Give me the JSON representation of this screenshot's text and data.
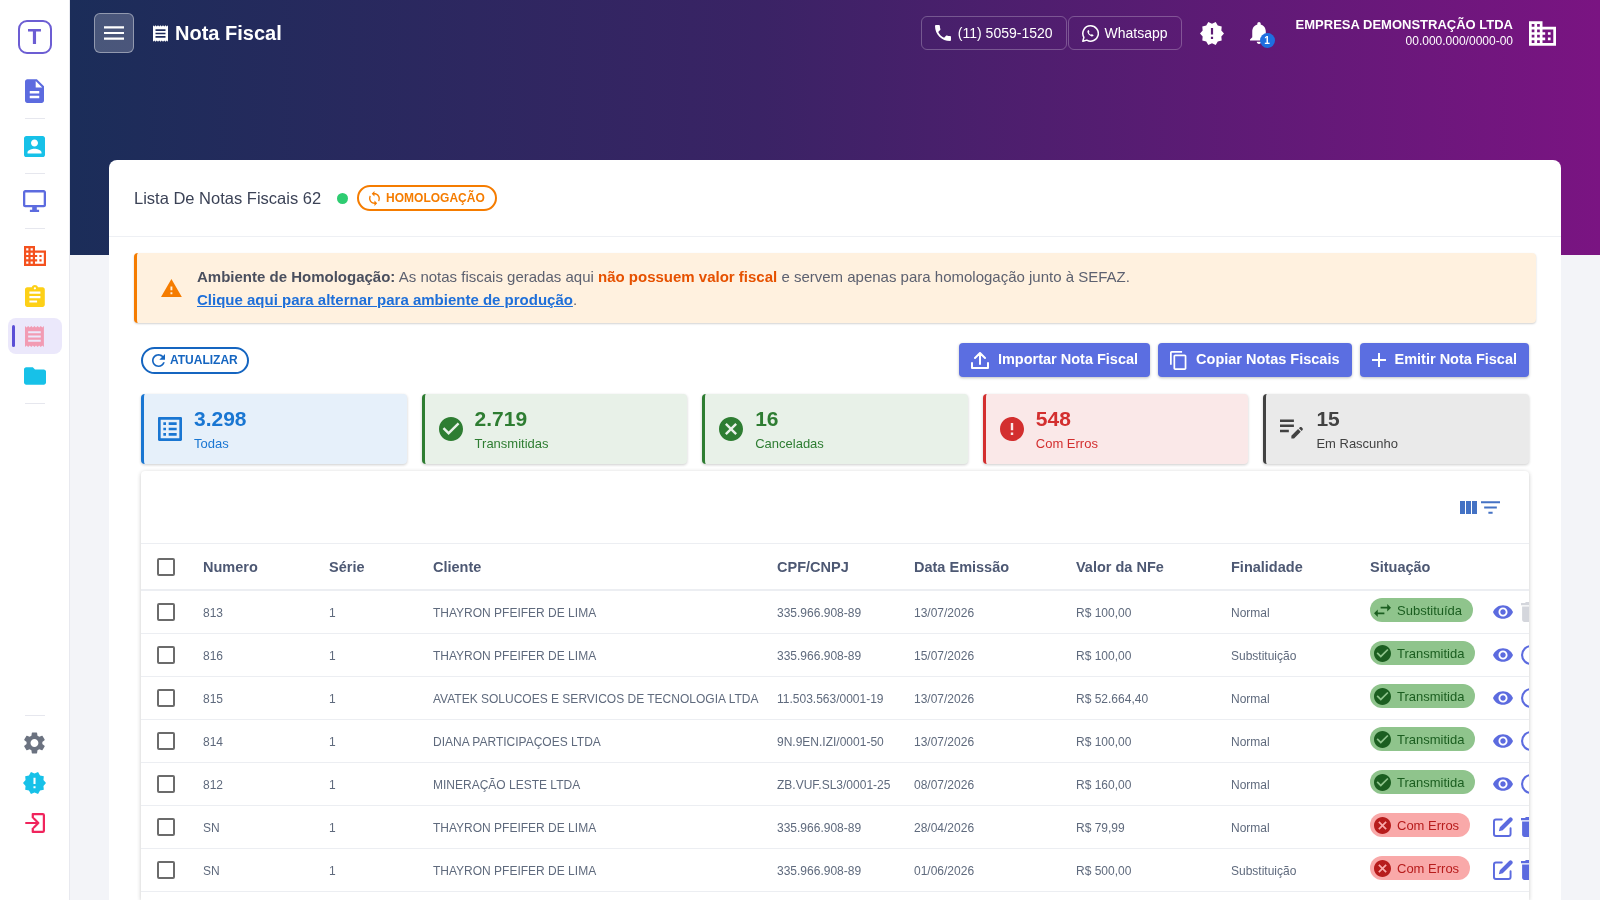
{
  "sidebar": {
    "logo": "T",
    "groups": [
      {
        "items": [
          {
            "kind": "document",
            "selected": false
          }
        ]
      },
      {
        "items": [
          {
            "kind": "contact",
            "selected": false
          }
        ]
      },
      {
        "items": [
          {
            "kind": "monitor",
            "selected": false
          }
        ]
      },
      {
        "items": [
          {
            "kind": "building",
            "selected": false
          },
          {
            "kind": "clipboard",
            "selected": false
          },
          {
            "kind": "receipt",
            "selected": true
          },
          {
            "kind": "folder",
            "selected": false
          }
        ]
      }
    ],
    "bottom_items": [
      {
        "kind": "settings",
        "selected": false
      },
      {
        "kind": "alert",
        "selected": false
      },
      {
        "kind": "logout",
        "selected": false
      }
    ]
  },
  "header": {
    "title": "Nota Fiscal",
    "phone": "(11) 5059-1520",
    "whatsapp": "Whatsapp",
    "notifications": "1",
    "company": {
      "name": "EMPRESA DEMONSTRAÇÃO LTDA",
      "tax_id": "00.000.000/0000-00"
    }
  },
  "list": {
    "title": "Lista De Notas Fiscais 62",
    "online": true,
    "environment": "HOMOLOGAÇÃO"
  },
  "alert": {
    "title": "Ambiente de Homologação:",
    "text": "As notas fiscais geradas aqui **não possuem valor fiscal** e servem apenas para homologação junto à SEFAZ.",
    "link": "Clique aqui para alternar para ambiente de produção",
    "end": "."
  },
  "toolbar": {
    "refresh": "ATUALIZAR",
    "actions": [
      {
        "kind": "import",
        "label": "Importar Nota Fiscal"
      },
      {
        "kind": "copy",
        "label": "Copiar Notas Fiscais"
      },
      {
        "kind": "create",
        "label": "Emitir Nota Fiscal"
      }
    ]
  },
  "stats": [
    {
      "kind": "all",
      "value": "3.298",
      "label": "Todas",
      "color": "#1976d2"
    },
    {
      "kind": "transmitted",
      "value": "2.719",
      "label": "Transmitidas",
      "color": "#2e7d32"
    },
    {
      "kind": "cancelled",
      "value": "16",
      "label": "Canceladas",
      "color": "#2e7d32"
    },
    {
      "kind": "error",
      "value": "548",
      "label": "Com Erros",
      "color": "#d32f2f"
    },
    {
      "kind": "draft",
      "value": "15",
      "label": "Em Rascunho",
      "color": "#424242"
    }
  ],
  "table": {
    "all_checked": false,
    "columns": [
      "Numero",
      "Série",
      "Cliente",
      "CPF/CNPJ",
      "Data Emissão",
      "Valor da NFe",
      "Finalidade",
      "Situação"
    ],
    "rows": [
      {
        "checked": false,
        "number": "813",
        "series": "1",
        "client": "THAYRON PFEIFER DE LIMA",
        "tax_id": "335.966.908-89",
        "issue_date": "13/07/2026",
        "amount": "R$ 100,00",
        "purpose": "Normal",
        "status": {
          "kind": "replaced",
          "label": "Substituída"
        },
        "actions": [
          {
            "kind": "view",
            "disabled": false
          },
          {
            "kind": "delete",
            "disabled": true
          }
        ]
      },
      {
        "checked": false,
        "number": "816",
        "series": "1",
        "client": "THAYRON PFEIFER DE LIMA",
        "tax_id": "335.966.908-89",
        "issue_date": "15/07/2026",
        "amount": "R$ 100,00",
        "purpose": "Substituição",
        "status": {
          "kind": "transmitted",
          "label": "Transmitida"
        },
        "actions": [
          {
            "kind": "view",
            "disabled": false
          },
          {
            "kind": "cancel",
            "disabled": false
          }
        ]
      },
      {
        "checked": false,
        "number": "815",
        "series": "1",
        "client": "AVATEK SOLUCOES E SERVICOS DE TECNOLOGIA LTDA",
        "tax_id": "11.503.563/0001-19",
        "issue_date": "13/07/2026",
        "amount": "R$ 52.664,40",
        "purpose": "Normal",
        "status": {
          "kind": "transmitted",
          "label": "Transmitida"
        },
        "actions": [
          {
            "kind": "view",
            "disabled": false
          },
          {
            "kind": "cancel",
            "disabled": false
          }
        ]
      },
      {
        "checked": false,
        "number": "814",
        "series": "1",
        "client": "DIANA PARTICIPAÇOES LTDA",
        "tax_id": "9N.9EN.IZI/0001-50",
        "issue_date": "13/07/2026",
        "amount": "R$ 100,00",
        "purpose": "Normal",
        "status": {
          "kind": "transmitted",
          "label": "Transmitida"
        },
        "actions": [
          {
            "kind": "view",
            "disabled": false
          },
          {
            "kind": "cancel",
            "disabled": false
          }
        ]
      },
      {
        "checked": false,
        "number": "812",
        "series": "1",
        "client": "MINERAÇÃO LESTE LTDA",
        "tax_id": "ZB.VUF.SL3/0001-25",
        "issue_date": "08/07/2026",
        "amount": "R$ 160,00",
        "purpose": "Normal",
        "status": {
          "kind": "transmitted",
          "label": "Transmitida"
        },
        "actions": [
          {
            "kind": "view",
            "disabled": false
          },
          {
            "kind": "cancel",
            "disabled": false
          }
        ]
      },
      {
        "checked": false,
        "number": "SN",
        "series": "1",
        "client": "THAYRON PFEIFER DE LIMA",
        "tax_id": "335.966.908-89",
        "issue_date": "28/04/2026",
        "amount": "R$ 79,99",
        "purpose": "Normal",
        "status": {
          "kind": "error",
          "label": "Com Erros"
        },
        "actions": [
          {
            "kind": "edit",
            "disabled": false
          },
          {
            "kind": "delete",
            "disabled": false
          }
        ]
      },
      {
        "checked": false,
        "number": "SN",
        "series": "1",
        "client": "THAYRON PFEIFER DE LIMA",
        "tax_id": "335.966.908-89",
        "issue_date": "01/06/2026",
        "amount": "R$ 500,00",
        "purpose": "Substituição",
        "status": {
          "kind": "error",
          "label": "Com Erros"
        },
        "actions": [
          {
            "kind": "edit",
            "disabled": false
          },
          {
            "kind": "delete",
            "disabled": false
          }
        ]
      }
    ]
  }
}
